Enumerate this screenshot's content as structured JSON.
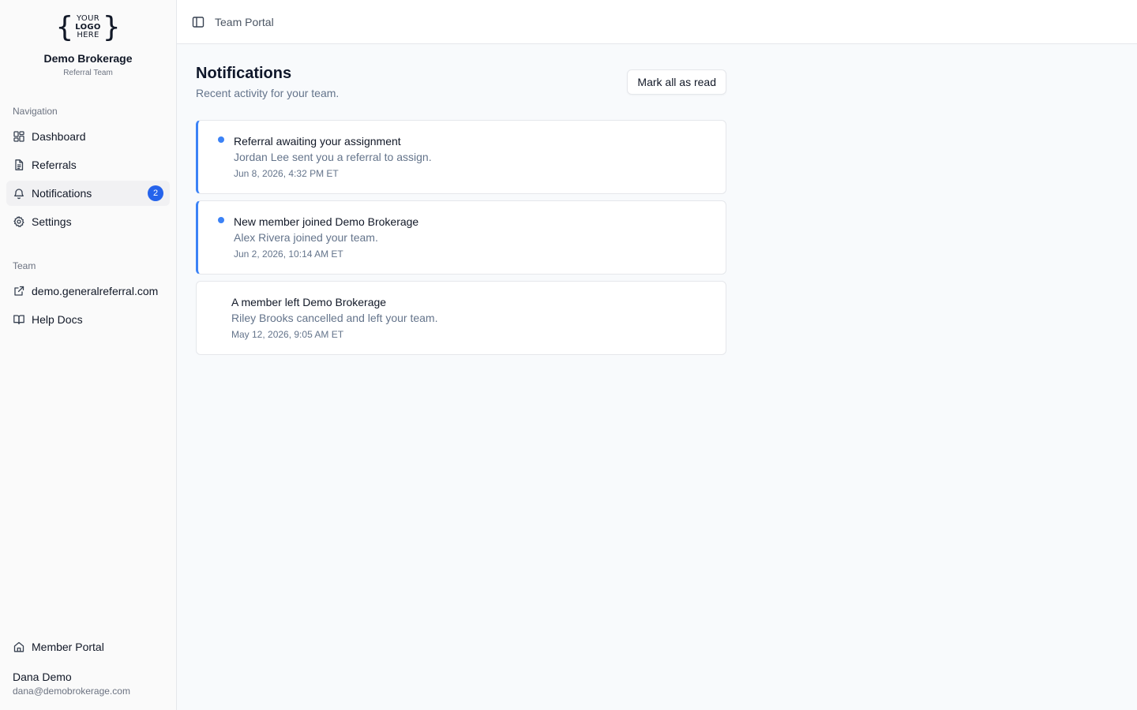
{
  "brand": {
    "logo_text": [
      "YOUR",
      "LOGO",
      "HERE"
    ],
    "name": "Demo Brokerage",
    "subtitle": "Referral Team"
  },
  "sidebar": {
    "navigation_label": "Navigation",
    "nav_items": [
      {
        "label": "Dashboard",
        "icon": "dashboard-icon"
      },
      {
        "label": "Referrals",
        "icon": "document-icon"
      },
      {
        "label": "Notifications",
        "icon": "bell-icon",
        "active": true,
        "badge": "2"
      },
      {
        "label": "Settings",
        "icon": "gear-icon"
      }
    ],
    "team_label": "Team",
    "team_items": [
      {
        "label": "demo.generalreferral.com",
        "icon": "external-link-icon"
      },
      {
        "label": "Help Docs",
        "icon": "book-icon"
      }
    ],
    "member_portal": {
      "label": "Member Portal",
      "icon": "home-icon"
    },
    "user": {
      "name": "Dana Demo",
      "email": "dana@demobrokerage.com"
    }
  },
  "topbar": {
    "title": "Team Portal",
    "toggle_icon": "sidebar-toggle-icon"
  },
  "page": {
    "title": "Notifications",
    "subtitle": "Recent activity for your team.",
    "mark_all_label": "Mark all as read"
  },
  "notifications": [
    {
      "title": "Referral awaiting your assignment",
      "description": "Jordan Lee sent you a referral to assign.",
      "time": "Jun 8, 2026, 4:32 PM ET",
      "unread": true
    },
    {
      "title": "New member joined Demo Brokerage",
      "description": "Alex Rivera joined your team.",
      "time": "Jun 2, 2026, 10:14 AM ET",
      "unread": true
    },
    {
      "title": "A member left Demo Brokerage",
      "description": "Riley Brooks cancelled and left your team.",
      "time": "May 12, 2026, 9:05 AM ET",
      "unread": false
    }
  ],
  "colors": {
    "accent": "#3b82f6",
    "badge": "#2563eb",
    "sidebar_bg": "#fafafa",
    "page_bg": "#f8fafc"
  }
}
